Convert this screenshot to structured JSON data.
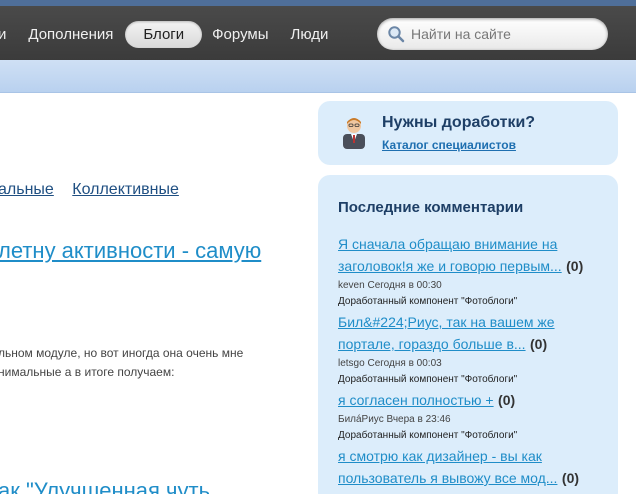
{
  "nav": {
    "items": [
      {
        "label": "и"
      },
      {
        "label": "Дополнения"
      },
      {
        "label": "Блоги"
      },
      {
        "label": "Форумы"
      },
      {
        "label": "Люди"
      }
    ],
    "active_index": 2
  },
  "search": {
    "placeholder": "Найти на сайте",
    "icon": "search-icon"
  },
  "main": {
    "tabs": [
      {
        "label": "альные"
      },
      {
        "label": "Коллективные"
      }
    ],
    "post_title": "летну активности - самую",
    "post_text_line1": "льном модуле, но вот иногда она очень мне",
    "post_text_line2": "нимальные а в итоге получаем:",
    "post_title_2": "ак \"Улучшенная чуть"
  },
  "sidebar": {
    "help": {
      "title": "Нужны доработки?",
      "link": "Каталог специалистов",
      "icon": "specialist-avatar-icon"
    },
    "comments": {
      "title": "Последние комментарии",
      "items": [
        {
          "line1": "Я сначала обращаю внимание на",
          "line2": "заголовок!я же и говорю первым...",
          "count": "(0)",
          "author": "keven",
          "time": "Сегодня в 00:30",
          "module": "Доработанный компонент \"Фотоблоги\""
        },
        {
          "line1": "Бил&#224;Риус, так на вашем же",
          "line2": "портале, гораздо больше в...",
          "count": "(0)",
          "author": "letsgo",
          "time": "Сегодня в 00:03",
          "module": "Доработанный компонент \"Фотоблоги\""
        },
        {
          "line1": "я согласен полностью +",
          "line2": "",
          "count": "(0)",
          "author": "БилáРиус",
          "time": "Вчера в 23:46",
          "module": "Доработанный компонент \"Фотоблоги\""
        },
        {
          "line1": "я смотрю как дизайнер - вы как",
          "line2": "пользователь я вывожу все мод...",
          "count": "(0)",
          "author": "",
          "time": "",
          "module": ""
        }
      ]
    }
  }
}
